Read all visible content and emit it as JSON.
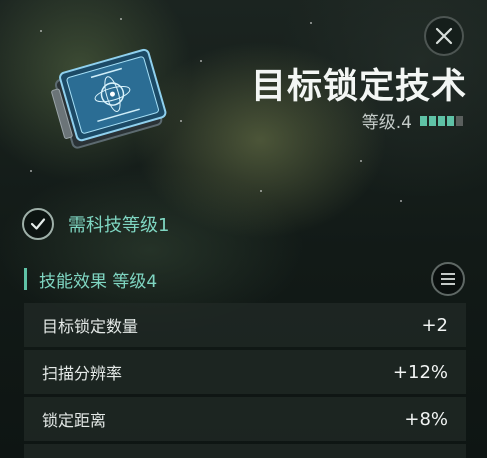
{
  "skill": {
    "title": "目标锁定技术",
    "level_label": "等级.4",
    "level_current": 4,
    "level_max": 5
  },
  "requirement": {
    "label": "需科技等级1",
    "met": true
  },
  "effects_section": {
    "label": "技能效果 等级4",
    "rows": [
      {
        "name": "目标锁定数量",
        "value": "+2"
      },
      {
        "name": "扫描分辨率",
        "value": "+12%"
      },
      {
        "name": "锁定距离",
        "value": "+8%"
      }
    ]
  },
  "icons": {
    "close": "close-icon",
    "check": "check-icon",
    "menu": "menu-icon",
    "skill_book": "skill-book-icon"
  },
  "colors": {
    "accent": "#5fc2a6",
    "accent_text": "#7fd6c2",
    "pip_empty": "#5b605e"
  }
}
